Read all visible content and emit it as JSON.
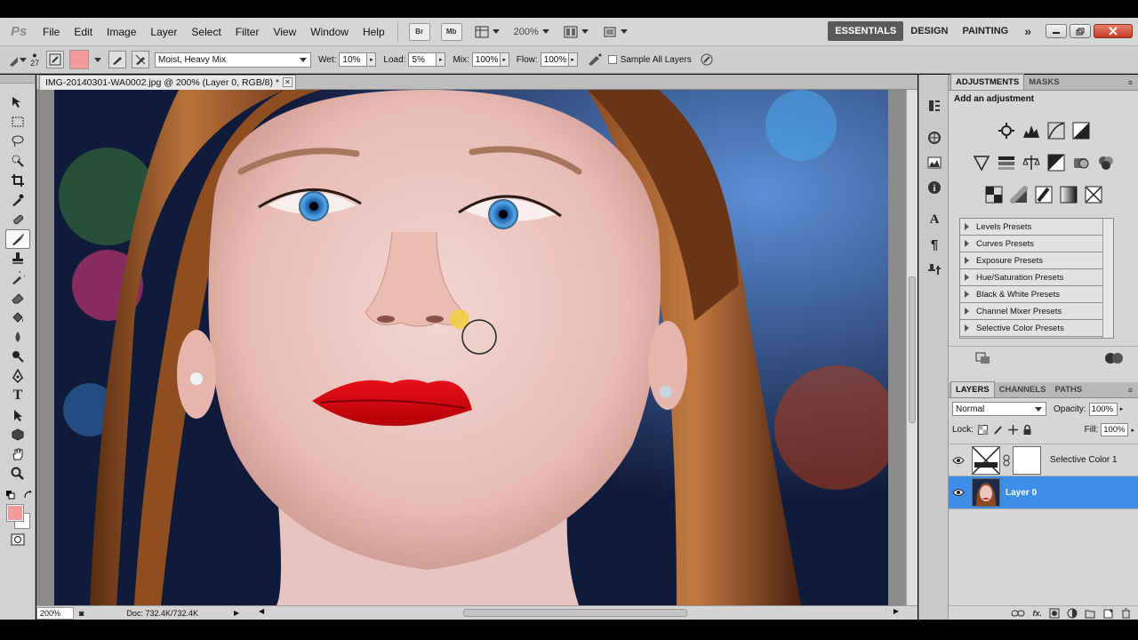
{
  "app": {
    "logo": "Ps"
  },
  "menu": [
    "File",
    "Edit",
    "Image",
    "Layer",
    "Select",
    "Filter",
    "View",
    "Window",
    "Help"
  ],
  "menubar": {
    "bridge": "Br",
    "minibridge": "Mb",
    "zoom": "200%"
  },
  "workspaces": {
    "active": "ESSENTIALS",
    "items": [
      "DESIGN",
      "PAINTING"
    ],
    "more": "»"
  },
  "options": {
    "brush_size": "27",
    "preset": "Moist, Heavy Mix",
    "wet_label": "Wet:",
    "wet": "10%",
    "load_label": "Load:",
    "load": "5%",
    "mix_label": "Mix:",
    "mix": "100%",
    "flow_label": "Flow:",
    "flow": "100%",
    "sample_all": "Sample All Layers",
    "foreground_color": "#f39a9a"
  },
  "document": {
    "tab_title": "IMG-20140301-WA0002.jpg @ 200% (Layer 0, RGB/8) *",
    "zoom": "200%",
    "info": "Doc: 732.4K/732.4K"
  },
  "adjustments": {
    "tabs": [
      "ADJUSTMENTS",
      "MASKS"
    ],
    "heading": "Add an adjustment",
    "presets": [
      "Levels Presets",
      "Curves Presets",
      "Exposure Presets",
      "Hue/Saturation Presets",
      "Black & White Presets",
      "Channel Mixer Presets",
      "Selective Color Presets"
    ]
  },
  "layers": {
    "tabs": [
      "LAYERS",
      "CHANNELS",
      "PATHS"
    ],
    "blend_mode": "Normal",
    "opacity_label": "Opacity:",
    "opacity": "100%",
    "lock_label": "Lock:",
    "fill_label": "Fill:",
    "fill": "100%",
    "items": [
      {
        "name": "Selective Color 1",
        "selected": false
      },
      {
        "name": "Layer 0",
        "selected": true
      }
    ]
  },
  "colors": {
    "selection": "#3d8ee8",
    "accent": "#f39a9a"
  }
}
